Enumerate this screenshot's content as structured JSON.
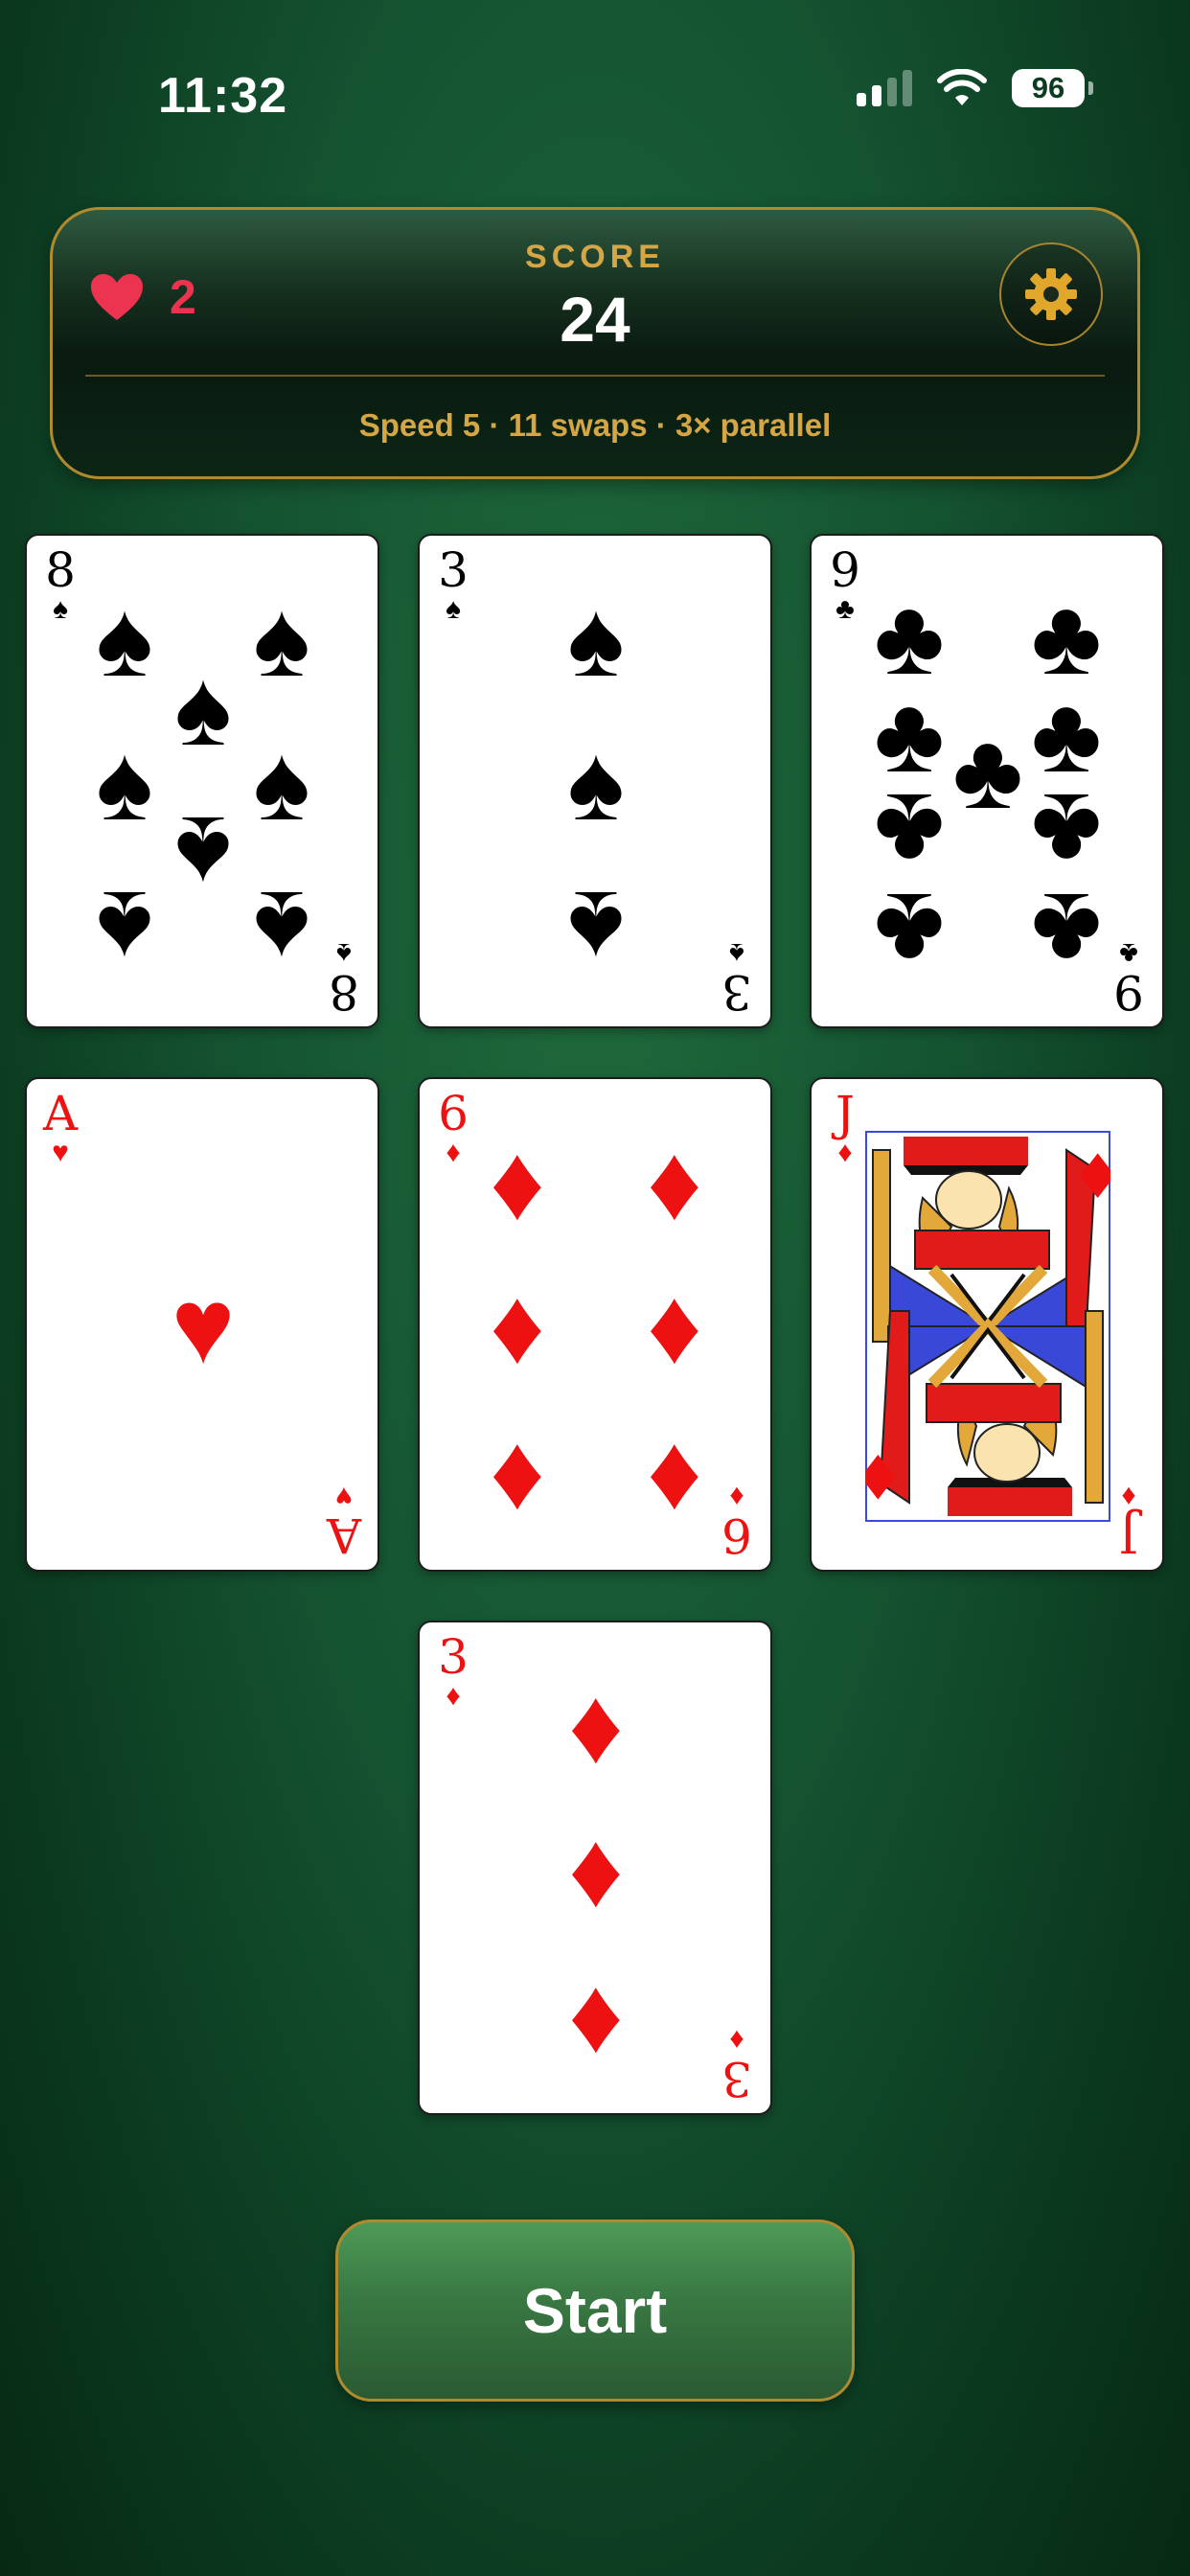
{
  "status_bar": {
    "time": "11:32",
    "battery": "96"
  },
  "hud": {
    "lives": "2",
    "score_label": "SCORE",
    "score": "24",
    "info": "Speed 5 · 11 swaps · 3× parallel"
  },
  "colors": {
    "felt": "#145230",
    "gold": "#d4a645",
    "heart": "#ec3451",
    "red_suit": "#ee1111"
  },
  "cards": [
    {
      "rank": "8",
      "suit": "♠",
      "color": "black"
    },
    {
      "rank": "3",
      "suit": "♠",
      "color": "black"
    },
    {
      "rank": "9",
      "suit": "♣",
      "color": "black"
    },
    {
      "rank": "A",
      "suit": "♥",
      "color": "red"
    },
    {
      "rank": "6",
      "suit": "♦",
      "color": "red"
    },
    {
      "rank": "J",
      "suit": "♦",
      "color": "red"
    },
    {
      "rank": "3",
      "suit": "♦",
      "color": "red"
    }
  ],
  "start_button": {
    "label": "Start"
  },
  "icons": {
    "lives": "heart-icon",
    "settings": "gear-icon",
    "signal": "signal-icon",
    "wifi": "wifi-icon",
    "battery": "battery-icon"
  }
}
